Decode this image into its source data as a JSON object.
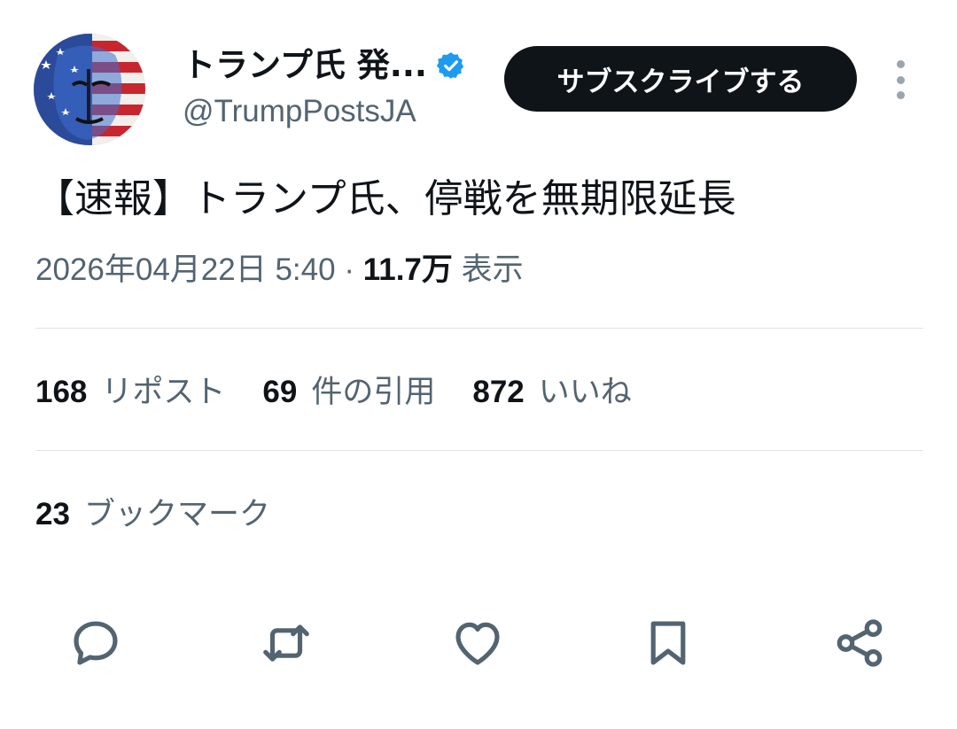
{
  "author": {
    "name": "トランプ氏 発...",
    "handle": "@TrumpPostsJA"
  },
  "subscribe_label": "サブスクライブする",
  "tweet": {
    "text": "【速報】トランプ氏、停戦を無期限延長",
    "timestamp": "2026年04月22日 5:40",
    "separator": "·",
    "views_count": "11.7万",
    "views_label": "表示"
  },
  "stats": {
    "reposts": {
      "count": "168",
      "label": "リポスト"
    },
    "quotes": {
      "count": "69",
      "label": "件の引用"
    },
    "likes": {
      "count": "872",
      "label": "いいね"
    },
    "bookmarks": {
      "count": "23",
      "label": "ブックマーク"
    }
  },
  "icons": {
    "verified": "verified-badge-icon",
    "more": "more-vertical-icon",
    "reply": "reply-icon",
    "repost": "repost-icon",
    "like": "heart-icon",
    "bookmark": "bookmark-icon",
    "share": "share-icon"
  },
  "colors": {
    "text_primary": "#0f1419",
    "text_secondary": "#536471",
    "verified_blue": "#1d9bf0",
    "button_bg": "#0f1419",
    "divider": "#dfe3e6"
  }
}
